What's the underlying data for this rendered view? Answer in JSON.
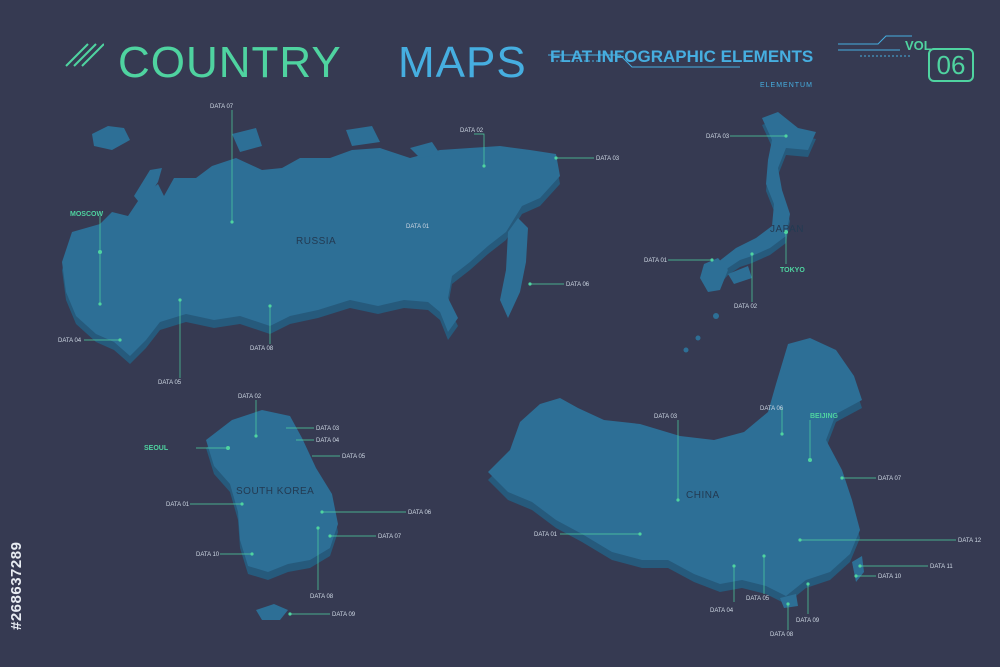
{
  "header": {
    "title_country": "COUNTRY",
    "title_maps": "MAPS",
    "subtitle": "FLAT INFOGRAPHIC ELEMENTS",
    "volume_label": "VOL.",
    "volume_number": "06",
    "brand": "ELEMENTUM"
  },
  "colors": {
    "background": "#363a52",
    "land": "#2d6f96",
    "land_top": "#3f88b5",
    "land_shadow": "#265a7c",
    "accent_green": "#4fd3a0",
    "accent_blue": "#46aee0",
    "label_text": "#cfd8e4",
    "country_text": "#233a52"
  },
  "maps": {
    "russia": {
      "name": "RUSSIA",
      "city": "MOSCOW",
      "labels": [
        "DATA 07",
        "DATA 02",
        "DATA 03",
        "DATA 01",
        "DATA 06",
        "DATA 04",
        "DATA 08",
        "DATA 05"
      ]
    },
    "japan": {
      "name": "JAPAN",
      "city": "TOKYO",
      "labels": [
        "DATA 03",
        "DATA 01",
        "DATA 02"
      ]
    },
    "south_korea": {
      "name": "SOUTH KOREA",
      "city": "SEOUL",
      "labels": [
        "DATA 02",
        "DATA 03",
        "DATA 04",
        "DATA 05",
        "DATA 01",
        "DATA 06",
        "DATA 07",
        "DATA 10",
        "DATA 08",
        "DATA 09"
      ]
    },
    "china": {
      "name": "CHINA",
      "city": "BEIJING",
      "labels": [
        "DATA 03",
        "DATA 06",
        "DATA 07",
        "DATA 01",
        "DATA 12",
        "DATA 11",
        "DATA 10",
        "DATA 04",
        "DATA 05",
        "DATA 09",
        "DATA 08"
      ]
    }
  },
  "watermark": "#268637289"
}
